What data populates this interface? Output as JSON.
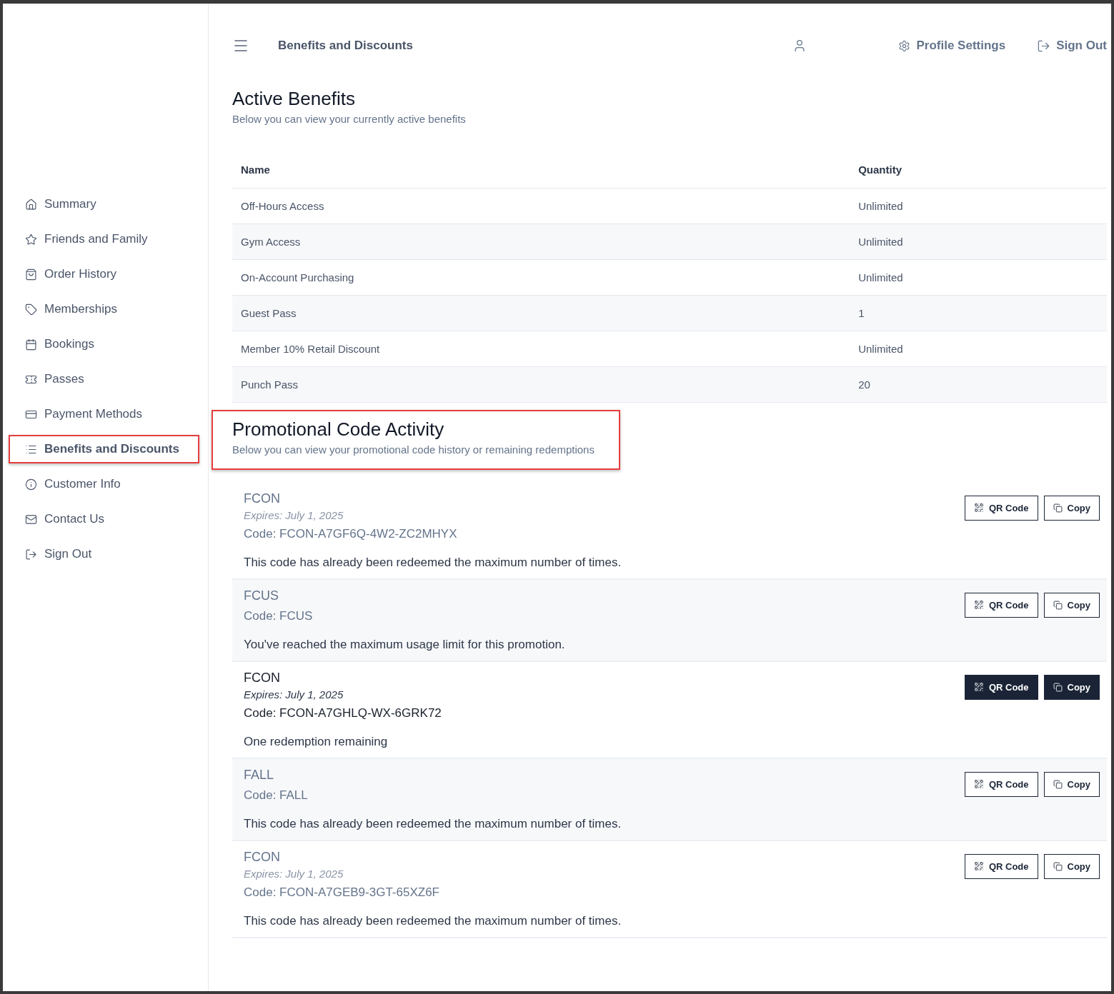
{
  "header": {
    "title": "Benefits and Discounts",
    "profile_settings": "Profile Settings",
    "sign_out": "Sign Out"
  },
  "sidebar": {
    "items": [
      {
        "label": "Summary",
        "selected": false
      },
      {
        "label": "Friends and Family",
        "selected": false
      },
      {
        "label": "Order History",
        "selected": false
      },
      {
        "label": "Memberships",
        "selected": false
      },
      {
        "label": "Bookings",
        "selected": false
      },
      {
        "label": "Passes",
        "selected": false
      },
      {
        "label": "Payment Methods",
        "selected": false
      },
      {
        "label": "Benefits and Discounts",
        "selected": true,
        "highlighted": true
      },
      {
        "label": "Customer Info",
        "selected": false
      },
      {
        "label": "Contact Us",
        "selected": false
      },
      {
        "label": "Sign Out",
        "selected": false
      }
    ]
  },
  "active_benefits": {
    "title": "Active Benefits",
    "subtitle": "Below you can view your currently active benefits",
    "columns": [
      "Name",
      "Quantity"
    ],
    "rows": [
      [
        "Off-Hours Access",
        "Unlimited"
      ],
      [
        "Gym Access",
        "Unlimited"
      ],
      [
        "On-Account Purchasing",
        "Unlimited"
      ],
      [
        "Guest Pass",
        "1"
      ],
      [
        "Member 10% Retail Discount",
        "Unlimited"
      ],
      [
        "Punch Pass",
        "20"
      ]
    ]
  },
  "promo": {
    "title": "Promotional Code Activity",
    "subtitle": "Below you can view your promotional code history or remaining redemptions",
    "highlighted": true,
    "codes": [
      {
        "name": "FCON",
        "expires": "Expires: July 1, 2025",
        "code": "Code: FCON-A7GF6Q-4W2-ZC2MHYX",
        "message": "This code has already been redeemed the maximum number of times.",
        "active": false,
        "qr_label": "QR Code",
        "copy_label": "Copy"
      },
      {
        "name": "FCUS",
        "code": "Code: FCUS",
        "message": "You've reached the maximum usage limit for this promotion.",
        "active": false,
        "qr_label": "QR Code",
        "copy_label": "Copy"
      },
      {
        "name": "FCON",
        "expires": "Expires: July 1, 2025",
        "code": "Code: FCON-A7GHLQ-WX-6GRK72",
        "message": "One redemption remaining",
        "active": true,
        "qr_label": "QR Code",
        "copy_label": "Copy"
      },
      {
        "name": "FALL",
        "code": "Code: FALL",
        "message": "This code has already been redeemed the maximum number of times.",
        "active": false,
        "qr_label": "QR Code",
        "copy_label": "Copy"
      },
      {
        "name": "FCON",
        "expires": "Expires: July 1, 2025",
        "code": "Code: FCON-A7GEB9-3GT-65XZ6F",
        "message": "This code has already been redeemed the maximum number of times.",
        "active": false,
        "qr_label": "QR Code",
        "copy_label": "Copy"
      }
    ]
  }
}
